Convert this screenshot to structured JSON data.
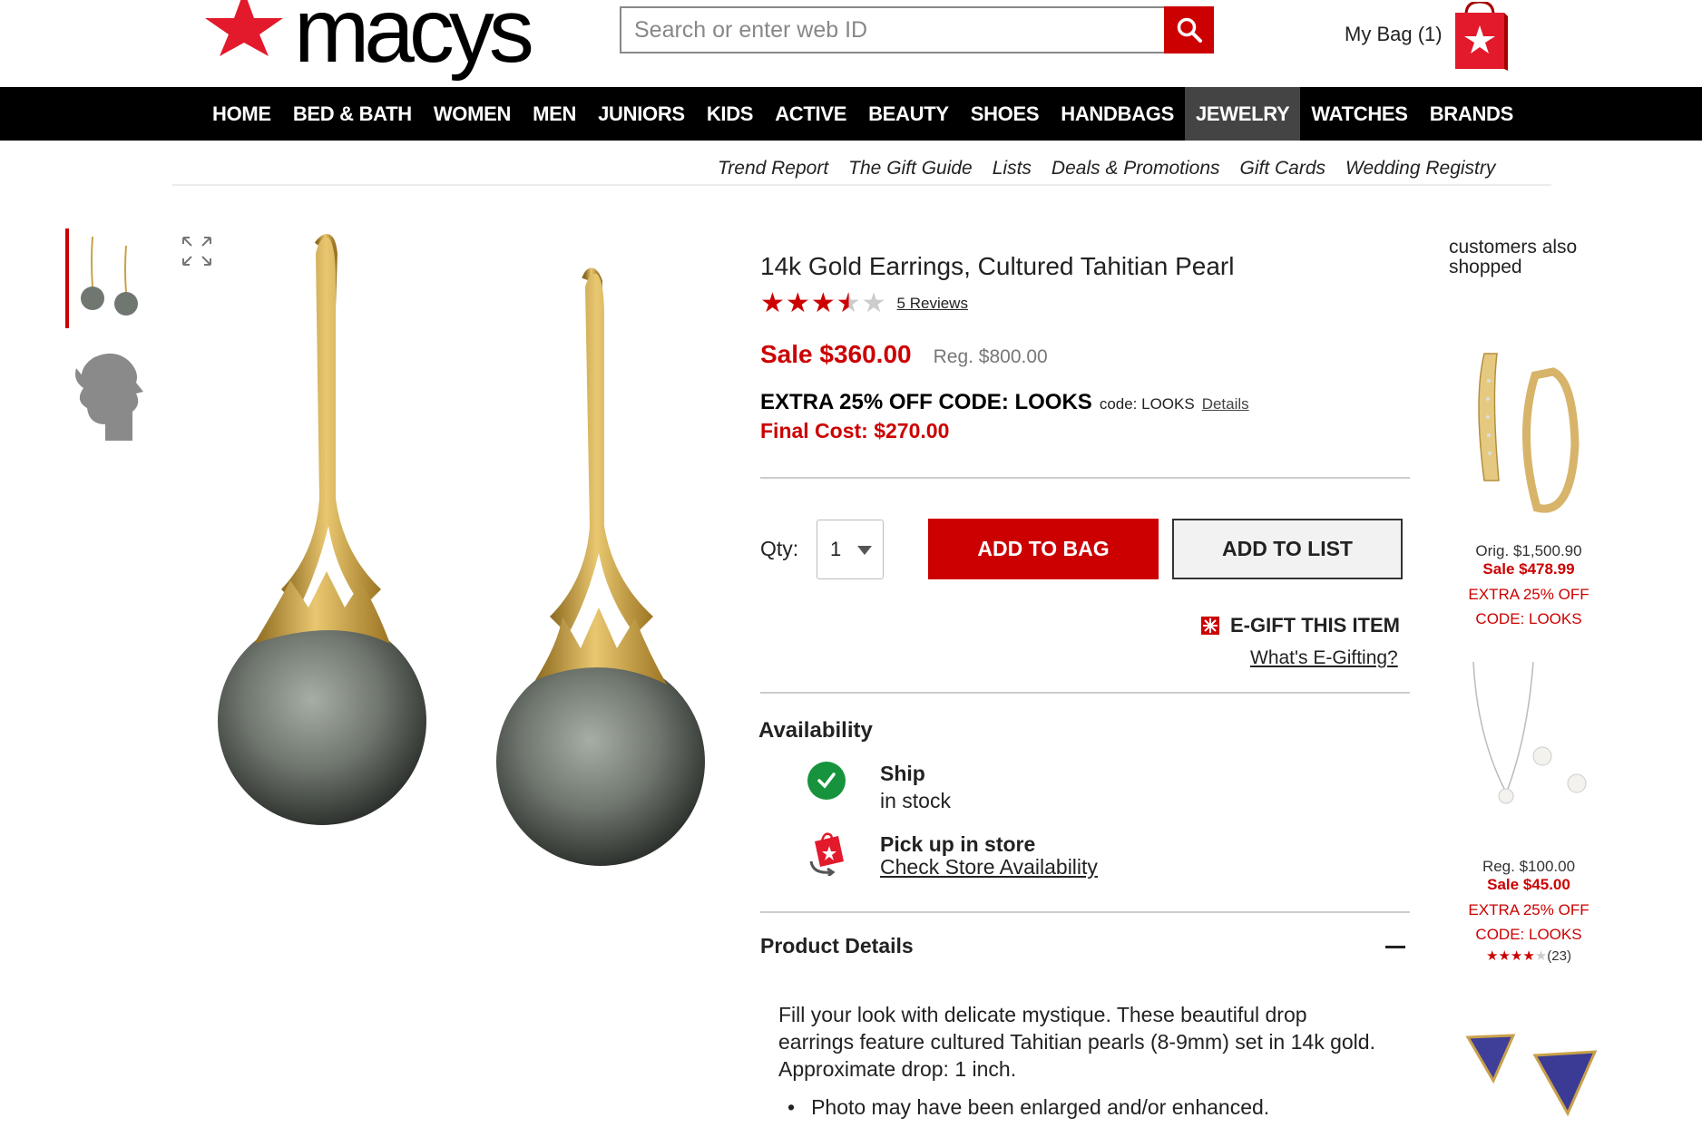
{
  "header": {
    "logo_text": "macys",
    "search_placeholder": "Search or enter web ID",
    "bag_label": "My Bag (1)"
  },
  "nav": {
    "items": [
      "HOME",
      "BED & BATH",
      "WOMEN",
      "MEN",
      "JUNIORS",
      "KIDS",
      "ACTIVE",
      "BEAUTY",
      "SHOES",
      "HANDBAGS",
      "JEWELRY",
      "WATCHES",
      "BRANDS"
    ],
    "active": "JEWELRY"
  },
  "subnav": {
    "items": [
      "Trend Report",
      "The Gift Guide",
      "Lists",
      "Deals & Promotions",
      "Gift Cards",
      "Wedding Registry"
    ]
  },
  "product": {
    "title": "14k Gold Earrings, Cultured Tahitian Pearl",
    "rating": 3.5,
    "reviews_label": "5 Reviews",
    "sale_price": "Sale $360.00",
    "reg_price": "Reg. $800.00",
    "promo_headline": "EXTRA 25% OFF CODE: LOOKS",
    "promo_code": "code: LOOKS",
    "promo_details": "Details",
    "final_cost": "Final Cost: $270.00",
    "qty_label": "Qty:",
    "qty_value": "1",
    "add_to_bag": "ADD TO BAG",
    "add_to_list": "ADD TO LIST",
    "egift_label": "E-GIFT THIS ITEM",
    "egift_what": "What's E-Gifting?",
    "availability_heading": "Availability",
    "ship_title": "Ship",
    "ship_status": "in stock",
    "pickup_title": "Pick up in store",
    "pickup_link": "Check Store Availability",
    "details_heading": "Product Details",
    "description": "Fill your look with delicate mystique. These beautiful drop earrings feature cultured Tahitian pearls (8-9mm) set in 14k gold. Approximate drop: 1 inch.",
    "bullets": [
      "Photo may have been enlarged and/or enhanced."
    ]
  },
  "sidebar": {
    "heading": "customers also shopped",
    "recs": [
      {
        "orig": "Orig. $1,500.90",
        "sale": "Sale $478.99",
        "extra": "EXTRA 25% OFF",
        "code": "CODE: LOOKS"
      },
      {
        "orig": "Reg. $100.00",
        "sale": "Sale $45.00",
        "extra": "EXTRA 25% OFF",
        "code": "CODE: LOOKS",
        "rating": 4,
        "count": "(23)"
      }
    ]
  },
  "colors": {
    "brand_red": "#cc0000",
    "nav_bg": "#000000",
    "in_stock_green": "#17933d"
  }
}
